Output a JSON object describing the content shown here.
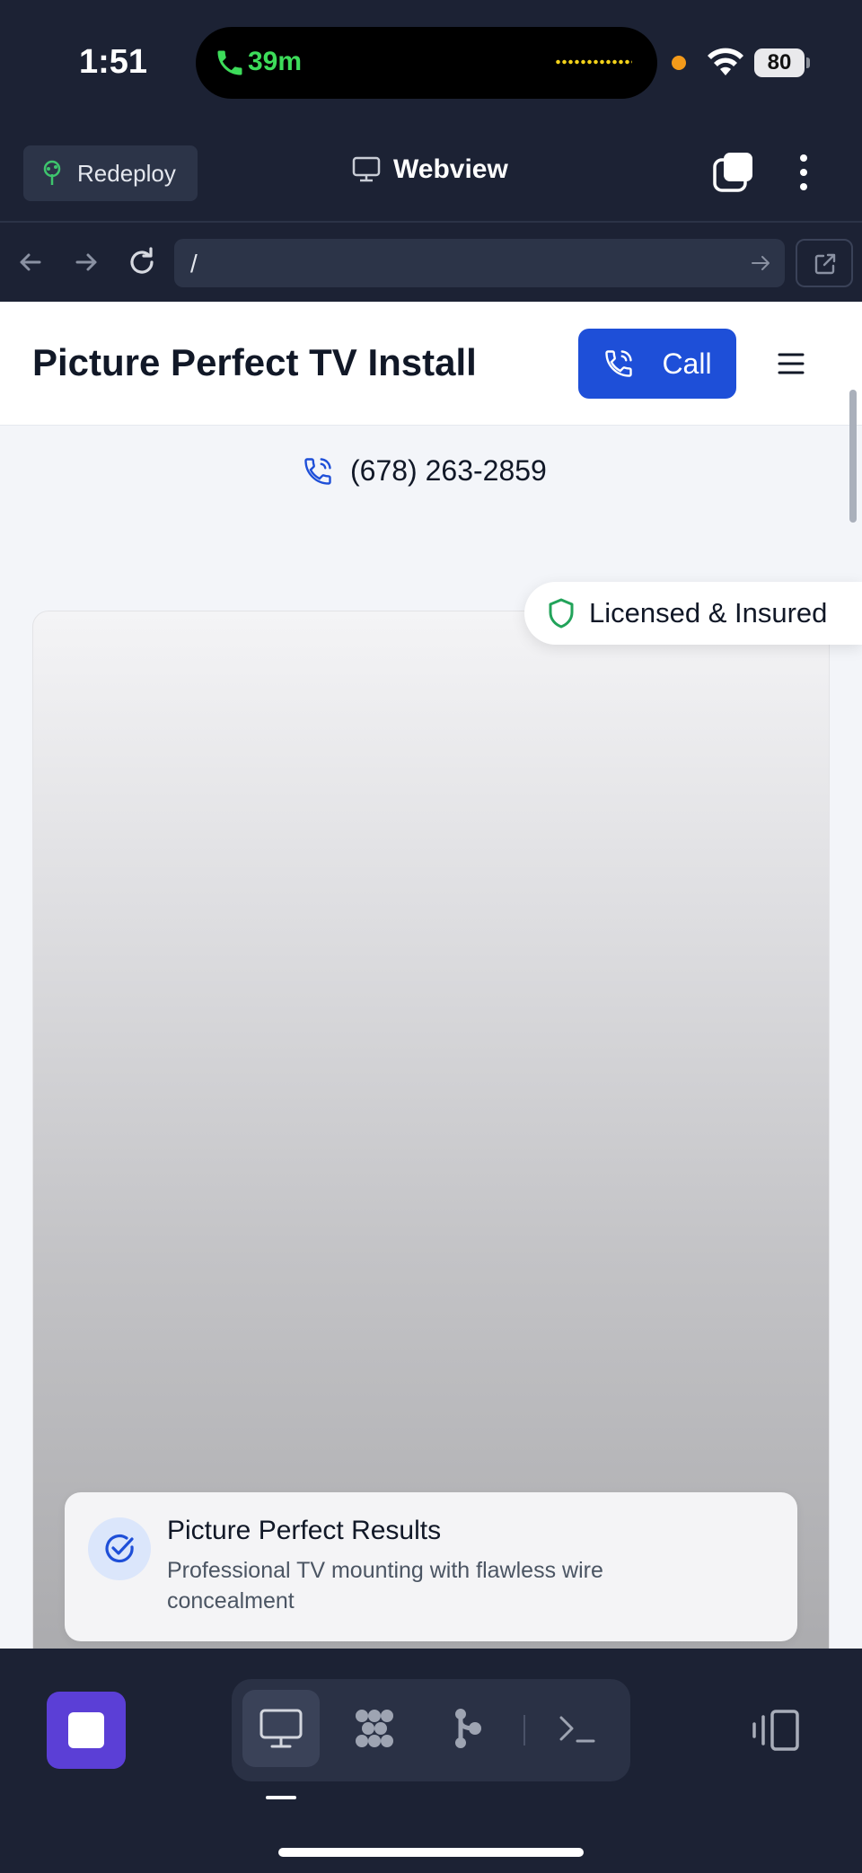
{
  "status_bar": {
    "time": "1:51",
    "call_duration": "39m",
    "battery": "80"
  },
  "app_header": {
    "redeploy_label": "Redeploy",
    "title": "Webview"
  },
  "url_bar": {
    "url": "/"
  },
  "site": {
    "title": "Picture Perfect TV Install",
    "call_label": "Call",
    "phone": "(678) 263-2859",
    "badge": "Licensed & Insured",
    "card_title": "Picture Perfect Results",
    "card_description": "Professional TV mounting with flawless wire concealment"
  },
  "colors": {
    "accent_blue": "#1e4fd8",
    "stop_purple": "#5b3fd6",
    "badge_green": "#22a35a",
    "app_bg": "#1c2234"
  },
  "icons": {
    "call_glyph": "phone-icon",
    "redeploy": "tree-icon",
    "webview": "monitor-icon",
    "licensed": "shield-icon",
    "results": "check-circle-icon"
  }
}
